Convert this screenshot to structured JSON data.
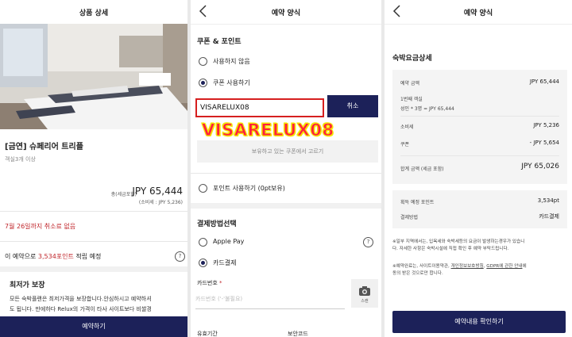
{
  "panel1": {
    "title": "상품 상세",
    "room_name": "[금연] 슈페리어 트리플",
    "guests": "객실3개 이상",
    "price_prefix": "총(세금포함)",
    "price": "JPY 65,444",
    "tax_note": "(소비세 : JPY 5,236)",
    "cancel_policy": "7월 26일까지 취소료 없음",
    "points_prefix": "이 예약으로 ",
    "points_value": "3,534포인트",
    "points_suffix": " 적립 예정",
    "best_price_title": "최저가 보장",
    "best_price_line1": "모든 숙박플랜은 최저가격을 보장합니다.안심하시고 예약하셔",
    "best_price_line2": "도 됩니다. 만에하다 Relux의 가격이 타사 사이트보다 비쌀경",
    "bottom_button": "예약하기"
  },
  "panel2": {
    "title": "예약 양식",
    "coupon_section": "쿠폰 & 포인트",
    "option_no_use": "사용하지 않음",
    "option_use_coupon": "쿠폰 사용하기",
    "coupon_code": "VISARELUX08",
    "cancel_button": "취소",
    "overlay_code": "VISARELUX08",
    "choose_coupon": "보유하고 있는 쿠폰에서 고르기",
    "option_use_points": "포인트 사용하기 (0pt보유)",
    "payment_section": "결제방법선택",
    "pay_apple": "Apple Pay",
    "pay_card": "카드결제",
    "card_label": "카드번호",
    "card_required": "*",
    "card_placeholder": "카드번호 ('-'불필요)",
    "scan_label": "스캔",
    "expiry_label": "유효기간",
    "security_label": "보안코드"
  },
  "panel3": {
    "title": "예약 양식",
    "section_title": "숙박요금상세",
    "booking_amount_label": "예약 금액",
    "booking_amount": "JPY 65,444",
    "room1_label": "1번째 객실",
    "room1_detail": "성인 * 3명 = JPY 65,444",
    "tax_label": "소비세",
    "tax_value": "JPY 5,236",
    "coupon_label": "쿠폰",
    "coupon_value": "- JPY 5,654",
    "total_label": "합계 금액 (세금 포함)",
    "total_value": "JPY 65,026",
    "points_label": "획득 예정 포인트",
    "points_value": "3,534pt",
    "method_label": "결제방법",
    "method_value": "카드결제",
    "note1_line1": "※일부 지역에서는, 입욕세와 숙박세등의 요금이 발생하는경우가 있습니",
    "note1_line2": "다. 자세한 사항은 숙박시설에 직접 확인 후 예약 부탁드립니다.",
    "note2_prefix": "※예약완료는, 사이트이용약관, ",
    "note2_link1": "개인정보보호방침",
    "note2_mid": ", ",
    "note2_link2": "GDPR에 관한 안내",
    "note2_suffix": "에",
    "note2_line2": "동의 받은 것으로만 합니다.",
    "confirm_button": "예약내용 확인하기"
  },
  "colors": {
    "navy": "#1c2159",
    "red": "#c0262b",
    "overlay": "#ff1f3d"
  }
}
